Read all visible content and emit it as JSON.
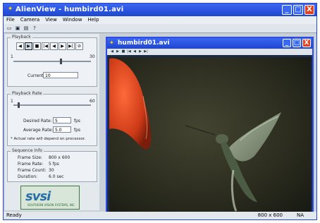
{
  "window": {
    "title": "AlienView - humbird01.avi",
    "minimize": "_",
    "maximize": "□",
    "close": "X"
  },
  "menu": [
    "File",
    "Camera",
    "View",
    "Window",
    "Help"
  ],
  "toolbar_icons": [
    "new-icon",
    "open-icon",
    "save-icon",
    "help-icon"
  ],
  "playback": {
    "group_label": "Playback",
    "controls": [
      "◀",
      "▶",
      "■",
      "|◀",
      "◀",
      "▶",
      "▶|",
      "⊘"
    ],
    "slider_left": "1",
    "slider_right": "30",
    "current_label": "Current:",
    "current_value": "10"
  },
  "framerate": {
    "group_label": "Playback Rate",
    "min": "1",
    "max": "60",
    "desired_label": "Desired Rate:",
    "desired_value": "5",
    "desired_unit": "fps",
    "average_label": "Average Rate:",
    "average_value": "5.0",
    "average_unit": "fps",
    "note": "* Actual rate will depend on processor."
  },
  "sequence": {
    "group_label": "Sequence Info",
    "rows": [
      {
        "label": "Frame Size:",
        "value": "800 x 600"
      },
      {
        "label": "Frame Rate:",
        "value": "5 fps"
      },
      {
        "label": "Frame Count:",
        "value": "30"
      },
      {
        "label": "Duration:",
        "value": "6.0 sec"
      }
    ]
  },
  "logo": {
    "text": "svsi",
    "tagline": "SOUTHERN VISION SYSTEMS, INC."
  },
  "status": {
    "left": "Ready",
    "right1": "800 x 600",
    "right2": "NA"
  },
  "child": {
    "title": "humbird01.avi",
    "controls": [
      "◀",
      "▶",
      "■",
      "|◀",
      "◀",
      "▶",
      "▶|"
    ]
  },
  "video": {
    "subject": "hummingbird"
  }
}
